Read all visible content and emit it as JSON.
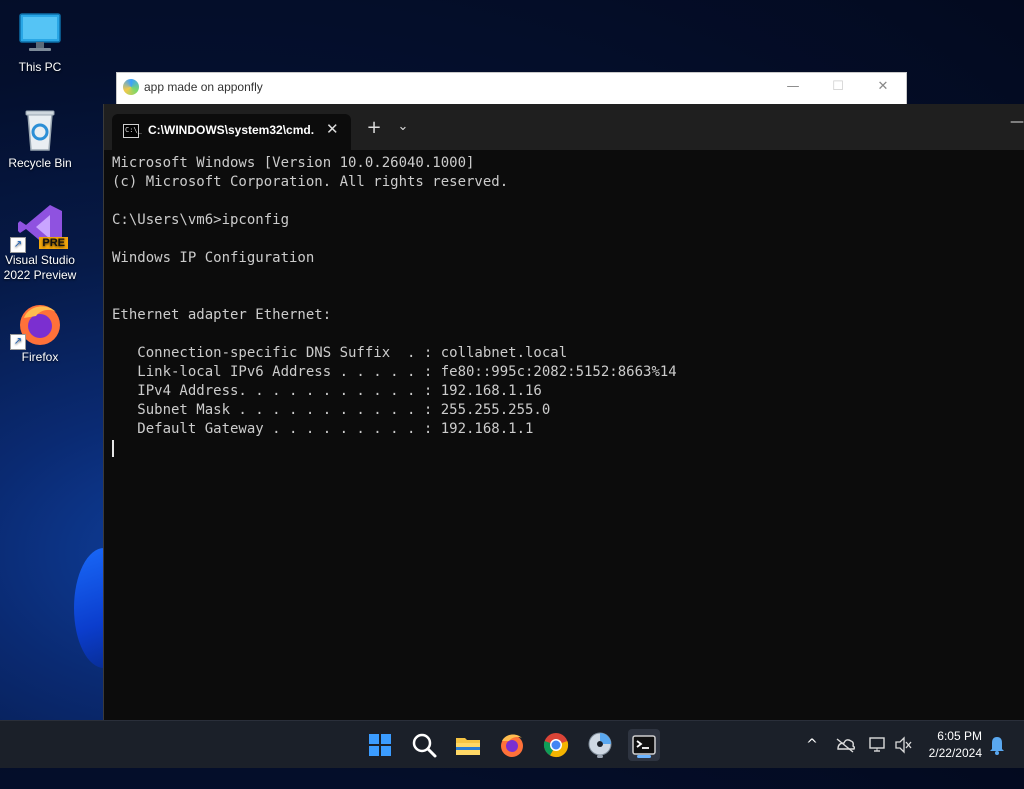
{
  "desktop": {
    "icons": [
      {
        "label": "This PC"
      },
      {
        "label": "Recycle Bin"
      },
      {
        "label": "Visual Studio\n2022 Preview",
        "badge": "PRE"
      },
      {
        "label": "Firefox"
      }
    ]
  },
  "background_window": {
    "title": "app made on apponfly",
    "minimize": "—",
    "maximize": "☐",
    "close": "✕"
  },
  "terminal": {
    "tab_title": "C:\\WINDOWS\\system32\\cmd.",
    "tab_icon_text": "C:\\_",
    "tab_close": "✕",
    "new_tab": "+",
    "dropdown": "⌄",
    "minimize": "—",
    "lines": [
      "Microsoft Windows [Version 10.0.26040.1000]",
      "(c) Microsoft Corporation. All rights reserved.",
      "",
      "C:\\Users\\vm6>ipconfig",
      "",
      "Windows IP Configuration",
      "",
      "",
      "Ethernet adapter Ethernet:",
      "",
      "   Connection-specific DNS Suffix  . : collabnet.local",
      "   Link-local IPv6 Address . . . . . : fe80::995c:2082:5152:8663%14",
      "   IPv4 Address. . . . . . . . . . . : 192.168.1.16",
      "   Subnet Mask . . . . . . . . . . . : 255.255.255.0",
      "   Default Gateway . . . . . . . . . : 192.168.1.1"
    ]
  },
  "taskbar": {
    "apps": [
      "start-icon",
      "search-icon",
      "file-explorer-icon",
      "firefox-icon",
      "chrome-icon",
      "dvd-app-icon",
      "terminal-icon"
    ],
    "tray": {
      "chevron": "^"
    },
    "clock": {
      "time": "6:05 PM",
      "date": "2/22/2024"
    }
  },
  "colors": {
    "terminal_bg": "#0c0c0c",
    "terminal_text": "#cccccc",
    "tabbar_bg": "#1f1f1f",
    "taskbar_bg": "#1b2029",
    "accent": "#6cb4ff"
  }
}
